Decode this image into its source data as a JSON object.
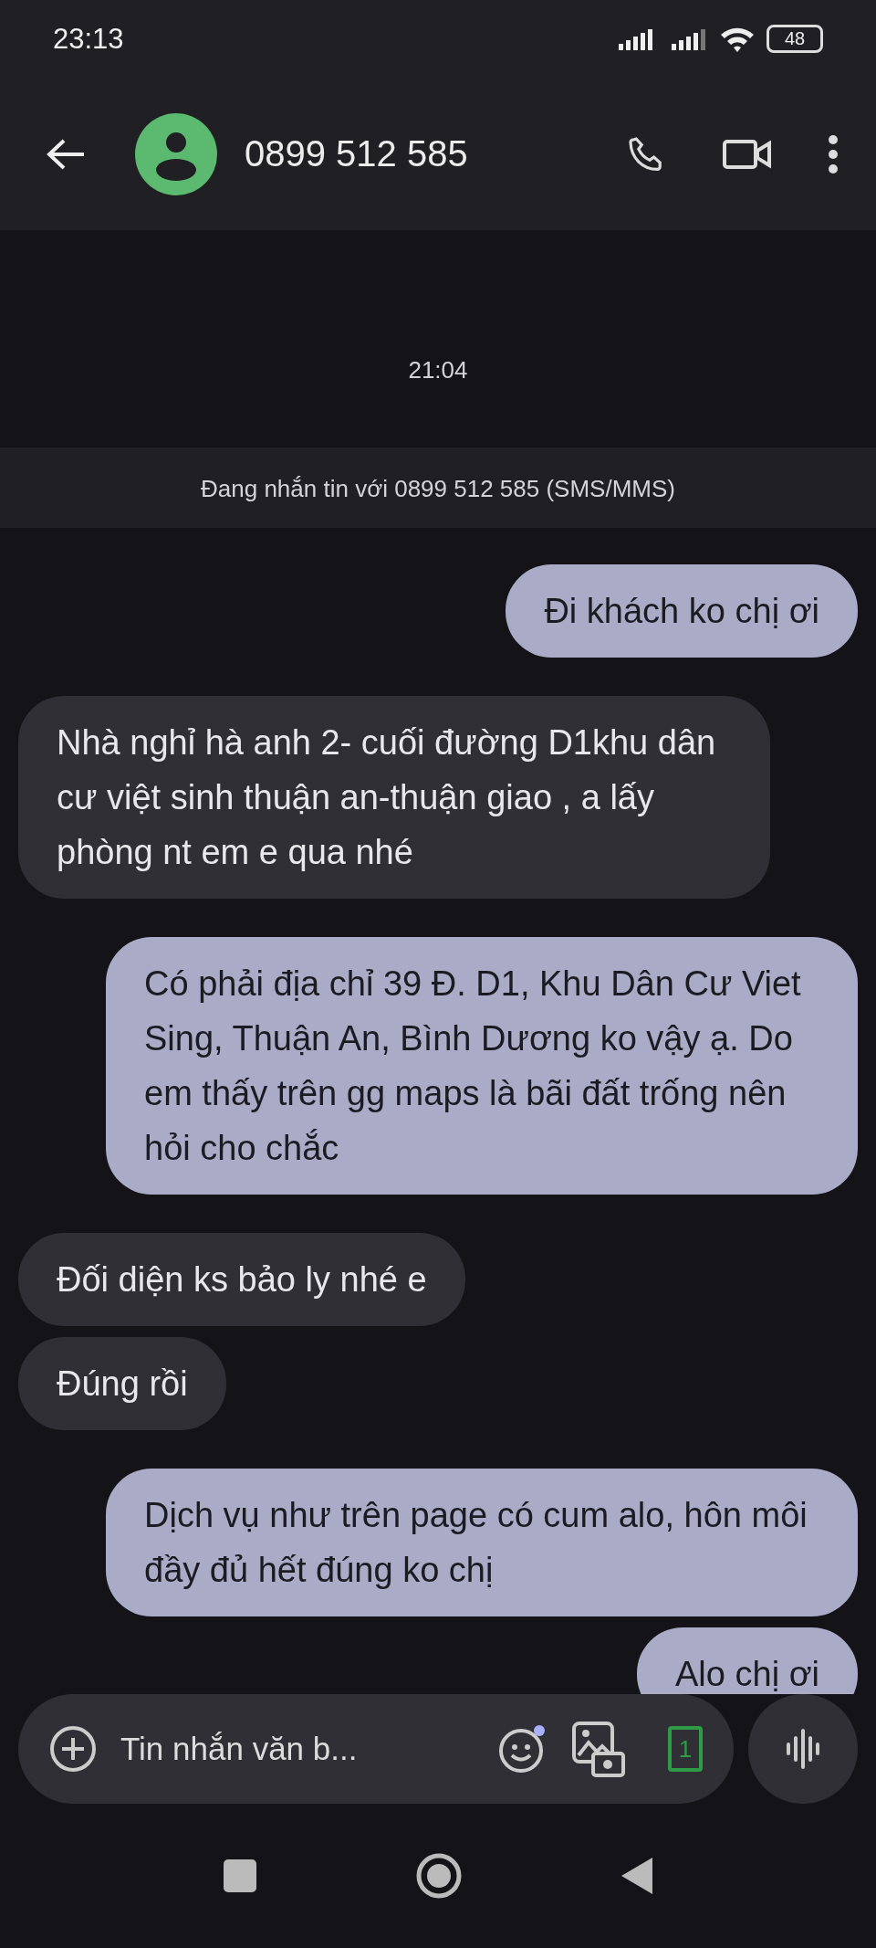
{
  "status_bar": {
    "time": "23:13",
    "battery": "48"
  },
  "header": {
    "contact": "0899 512 585"
  },
  "timestamp": "21:04",
  "info_banner": "Đang nhắn tin với 0899 512 585 (SMS/MMS)",
  "messages": [
    {
      "kind": "outgoing",
      "text": "Đi khách ko chị ơi"
    },
    {
      "kind": "incoming",
      "text": "Nhà nghỉ hà anh 2- cuối đường D1khu dân cư việt sinh thuận an-thuận giao , a lấy phòng nt em e qua nhé"
    },
    {
      "kind": "outgoing",
      "text": "Có phải địa chỉ 39 Đ. D1, Khu Dân Cư Viet Sing, Thuận An, Bình Dương ko vậy ạ. Do em thấy trên gg maps là bãi đất trống nên hỏi cho chắc"
    },
    {
      "kind": "incoming",
      "text": "Đối diện ks bảo ly nhé e"
    },
    {
      "kind": "incoming",
      "text": "Đúng rồi"
    },
    {
      "kind": "outgoing",
      "text": "Dịch vụ như trên page có cum alo, hôn môi đầy đủ hết đúng ko chị"
    },
    {
      "kind": "outgoing",
      "text": "Alo chị ơi"
    }
  ],
  "composer": {
    "placeholder": "Tin nhắn văn b...",
    "sim": "1"
  }
}
